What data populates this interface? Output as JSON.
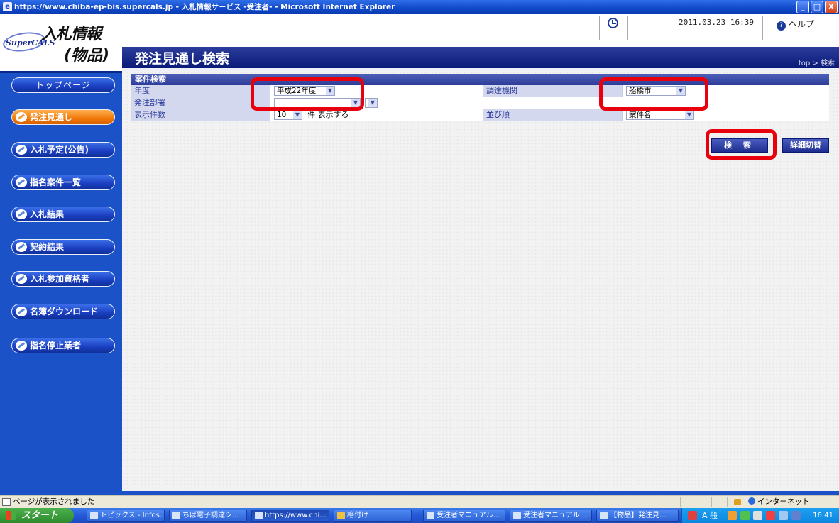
{
  "window": {
    "title": "https://www.chiba-ep-bis.supercals.jp - 入札情報サ－ビス -受注者- - Microsoft Internet Explorer",
    "min_label": "_",
    "max_label": "□",
    "close_label": "X"
  },
  "logo": {
    "brand": "SuperCALS",
    "line1": "入札情報",
    "line2": "(物品)"
  },
  "topbar": {
    "datetime": "2011.03.23 16:39",
    "help_label": "ヘルプ"
  },
  "page": {
    "title": "発注見通し検索",
    "breadcrumb": "top > 検索"
  },
  "sidebar": {
    "items": [
      {
        "label": "トップページ"
      },
      {
        "label": "発注見通し"
      },
      {
        "label": "入札予定(公告)"
      },
      {
        "label": "指名案件一覧"
      },
      {
        "label": "入札結果"
      },
      {
        "label": "契約結果"
      },
      {
        "label": "入札参加資格者"
      },
      {
        "label": "名簿ダウンロード"
      },
      {
        "label": "指名停止業者"
      }
    ]
  },
  "search": {
    "section_title": "案件検索",
    "fields": {
      "nendo_label": "年度",
      "nendo_value": "平成22年度",
      "kikan_label": "調達機関",
      "kikan_value": "船橋市",
      "busho_label": "発注部署",
      "busho_value": "",
      "count_label": "表示件数",
      "count_value": "10",
      "count_suffix": "件 表示する",
      "order_label": "並び順",
      "order_value": "案件名"
    },
    "search_button": "検 索",
    "detail_button": "詳細切替"
  },
  "status": {
    "text": "ページが表示されました",
    "zone": "インターネット"
  },
  "taskbar": {
    "start": "スタート",
    "tasks": [
      {
        "label": "トピックス - Infos..."
      },
      {
        "label": "ちば電子調達シ..."
      },
      {
        "label": "https://www.chi..."
      },
      {
        "label": "格付け"
      },
      {
        "label": "受注者マニュアル..."
      },
      {
        "label": "受注者マニュアル..."
      },
      {
        "label": "【物品】発注見..."
      }
    ],
    "tray_text": "A 般",
    "clock": "16:41"
  },
  "colors": {
    "highlight": "#e8000c",
    "sidebar_blue": "#1c52c8",
    "active_orange": "#f07808"
  }
}
